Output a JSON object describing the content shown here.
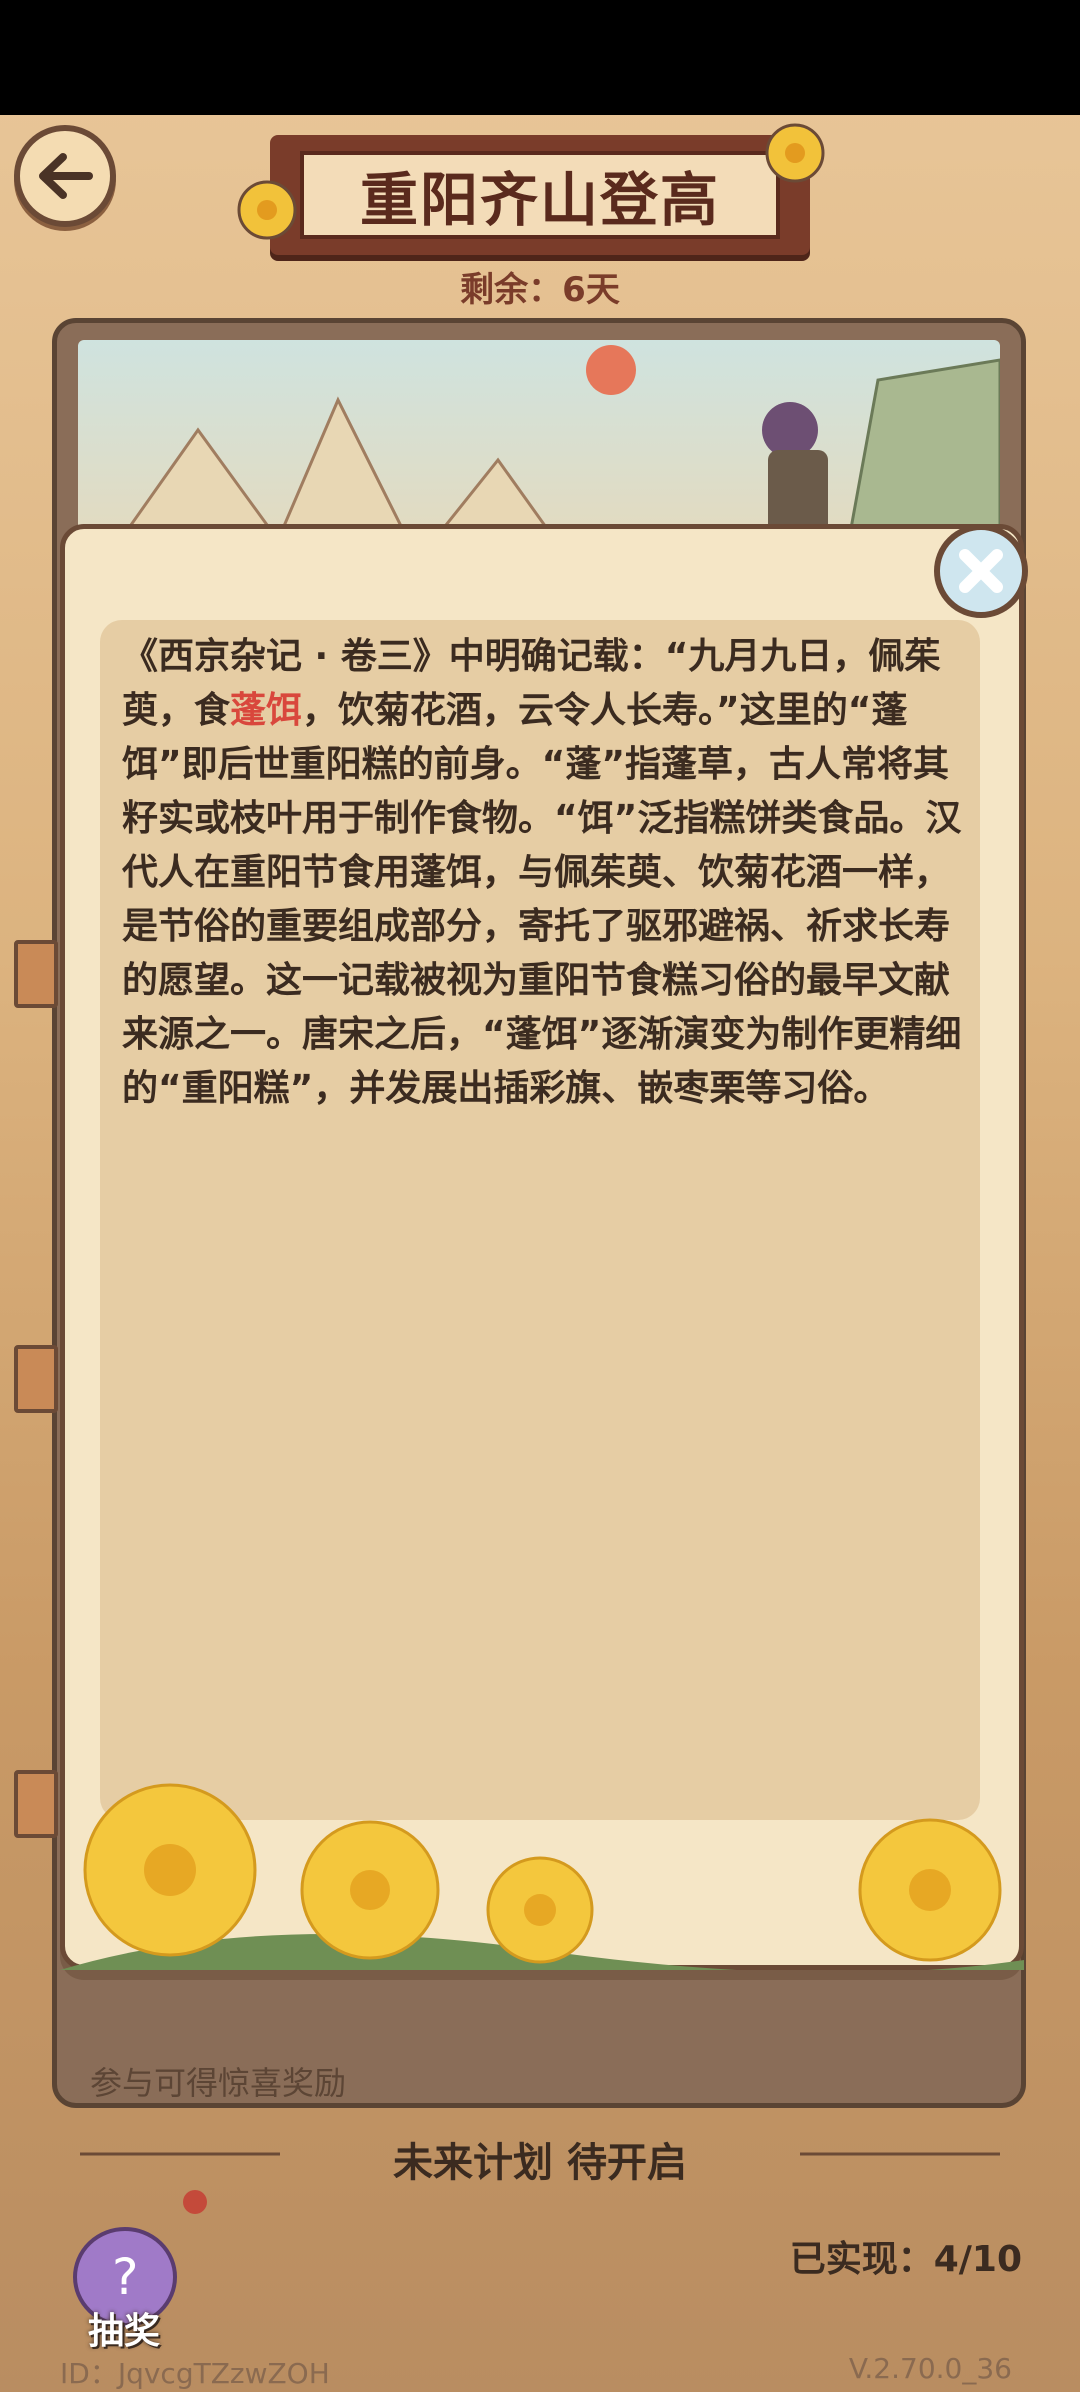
{
  "header": {
    "title": "重阳齐山登高",
    "remaining": "剩余：6天"
  },
  "modal": {
    "text_before": "《西京杂记 · 卷三》中明确记载：“九月九日，佩茱萸，食",
    "highlight": "蓬饵",
    "text_after": "，饮菊花酒，云令人长寿。”这里的“蓬饵”即后世重阳糕的前身。“蓬”指蓬草，古人常将其籽实或枝叶用于制作食物。“饵”泛指糕饼类食品。汉代人在重阳节食用蓬饵，与佩茱萸、饮菊花酒一样，是节俗的重要组成部分，寄托了驱邪避祸、祈求长寿的愿望。这一记载被视为重阳节食糕习俗的最早文献来源之一。唐宋之后，“蓬饵”逐渐演变为制作更精细的“重阳糕”，并发展出插彩旗、嵌枣栗等习俗。"
  },
  "card": {
    "reward_text": "参与可得惊喜奖励"
  },
  "footer": {
    "future_plan": "未来计划 待开启",
    "achieved": "已实现：4/10",
    "lottery_label": "抽奖",
    "user_id": "ID：JqvcgTZzwZOH",
    "version": "V.2.70.0_36"
  },
  "colors": {
    "highlight": "#d9473c",
    "frame": "#6b4a36",
    "paper": "#f5e6c6"
  }
}
